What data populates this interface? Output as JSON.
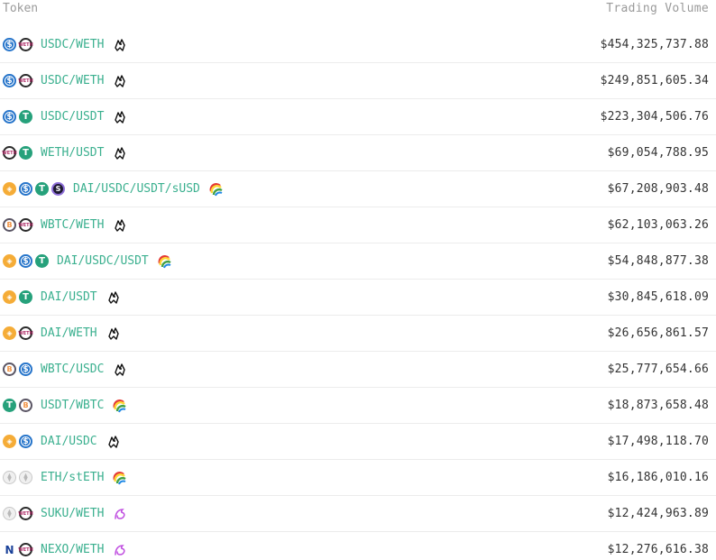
{
  "header": {
    "token": "Token",
    "volume": "Trading Volume"
  },
  "rows": [
    {
      "pair": "USDC/WETH",
      "volume": "$454,325,737.88",
      "tokens": [
        "usdc",
        "weth"
      ],
      "dex": "sushi-icon"
    },
    {
      "pair": "USDC/WETH",
      "volume": "$249,851,605.34",
      "tokens": [
        "usdc",
        "weth"
      ],
      "dex": "sushi-icon"
    },
    {
      "pair": "USDC/USDT",
      "volume": "$223,304,506.76",
      "tokens": [
        "usdc",
        "usdt"
      ],
      "dex": "sushi-icon"
    },
    {
      "pair": "WETH/USDT",
      "volume": "$69,054,788.95",
      "tokens": [
        "weth",
        "usdt"
      ],
      "dex": "sushi-icon"
    },
    {
      "pair": "DAI/USDC/USDT/sUSD",
      "volume": "$67,208,903.48",
      "tokens": [
        "dai",
        "usdc",
        "usdt",
        "susd"
      ],
      "dex": "curve-icon"
    },
    {
      "pair": "WBTC/WETH",
      "volume": "$62,103,063.26",
      "tokens": [
        "wbtc",
        "weth"
      ],
      "dex": "sushi-icon"
    },
    {
      "pair": "DAI/USDC/USDT",
      "volume": "$54,848,877.38",
      "tokens": [
        "dai",
        "usdc",
        "usdt"
      ],
      "dex": "curve-icon"
    },
    {
      "pair": "DAI/USDT",
      "volume": "$30,845,618.09",
      "tokens": [
        "dai",
        "usdt"
      ],
      "dex": "sushi-icon"
    },
    {
      "pair": "DAI/WETH",
      "volume": "$26,656,861.57",
      "tokens": [
        "dai",
        "weth"
      ],
      "dex": "sushi-icon"
    },
    {
      "pair": "WBTC/USDC",
      "volume": "$25,777,654.66",
      "tokens": [
        "wbtc",
        "usdc"
      ],
      "dex": "sushi-icon"
    },
    {
      "pair": "USDT/WBTC",
      "volume": "$18,873,658.48",
      "tokens": [
        "usdt",
        "wbtc"
      ],
      "dex": "curve-icon"
    },
    {
      "pair": "DAI/USDC",
      "volume": "$17,498,118.70",
      "tokens": [
        "dai",
        "usdc"
      ],
      "dex": "sushi-icon"
    },
    {
      "pair": "ETH/stETH",
      "volume": "$16,186,010.16",
      "tokens": [
        "eth",
        "steth"
      ],
      "dex": "curve-icon"
    },
    {
      "pair": "SUKU/WETH",
      "volume": "$12,424,963.89",
      "tokens": [
        "suku",
        "weth"
      ],
      "dex": "uniswap-icon"
    },
    {
      "pair": "NEXO/WETH",
      "volume": "$12,276,616.38",
      "tokens": [
        "nexo",
        "weth"
      ],
      "dex": "uniswap-icon"
    }
  ]
}
